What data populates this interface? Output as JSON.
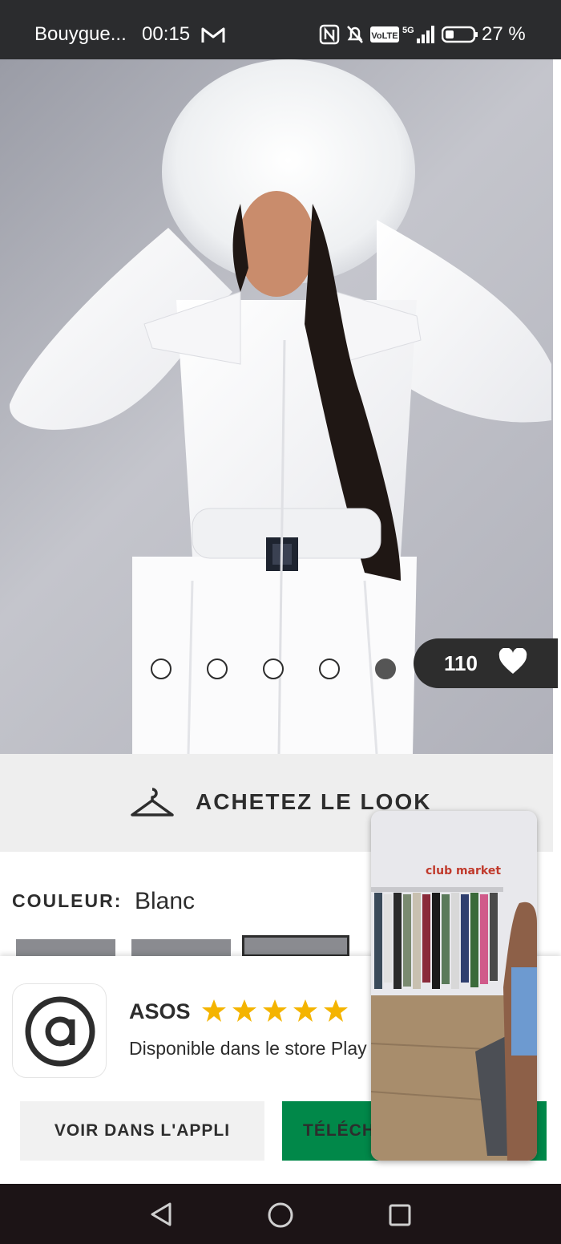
{
  "status_bar": {
    "carrier": "Bouygue...",
    "time": "00:15",
    "battery_percent": "27 %",
    "icons": [
      "gmail-icon",
      "nfc-icon",
      "mute-icon",
      "volte-icon",
      "5g-signal-icon",
      "battery-icon"
    ],
    "volte_text": "VoLTE",
    "network_text": "5G"
  },
  "hero": {
    "image": "product-photo-white-ski-suit",
    "carousel_dots": 5,
    "active_dot": 5,
    "likes": "110"
  },
  "shop_look": {
    "label": "ACHETEZ LE LOOK",
    "icon": "hanger-icon"
  },
  "product": {
    "colour_label": "COULEUR:",
    "colour_value": "Blanc"
  },
  "app_banner": {
    "app_name": "ASOS",
    "rating_stars": 5,
    "subtitle": "Disponible dans le store Play",
    "open_button": "VOIR DANS L'APPLI",
    "download_button": "TÉLÉCHARGER",
    "accent_color": "#018849"
  },
  "pip_video": {
    "logo_text": "club market"
  },
  "nav_bar": {
    "icons": [
      "back-icon",
      "home-icon",
      "recents-icon"
    ]
  }
}
